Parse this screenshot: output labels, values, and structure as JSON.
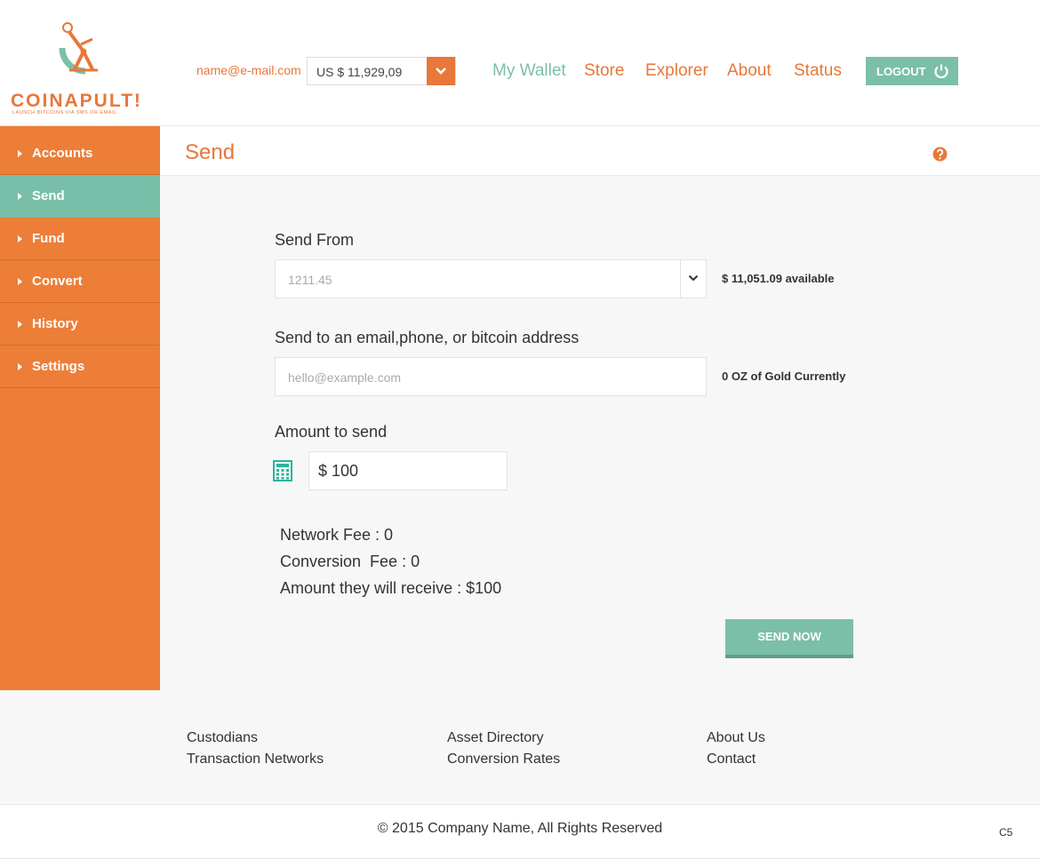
{
  "brand": {
    "name": "COINAPULT!",
    "tagline": "LAUNCH BITCOINS VIA SMS OR EMAIL",
    "accent": "#e8773a",
    "secondary": "#7bbfa8"
  },
  "header": {
    "email": "name@e-mail.com",
    "balance": "US $ 11,929,09",
    "nav": [
      "My Wallet",
      "Store",
      "Explorer",
      "About",
      "Status"
    ],
    "logout": "LOGOUT"
  },
  "sidebar": {
    "items": [
      {
        "label": "Accounts"
      },
      {
        "label": "Send"
      },
      {
        "label": "Fund"
      },
      {
        "label": "Convert"
      },
      {
        "label": "History"
      },
      {
        "label": "Settings"
      }
    ]
  },
  "main": {
    "title": "Send",
    "send_from": {
      "label": "Send From",
      "value": "1211.45",
      "available": "$ 11,051.09 available"
    },
    "send_to": {
      "label": "Send to an email,phone, or bitcoin address",
      "placeholder": "hello@example.com",
      "note": "0 OZ of Gold Currently"
    },
    "amount": {
      "label": "Amount to send",
      "value": "$ 100"
    },
    "summary": {
      "network_fee": "Network Fee : 0",
      "conversion_fee": "Conversion  Fee : 0",
      "receive": "Amount they will receive : $100"
    },
    "send_button": "SEND NOW"
  },
  "footer": {
    "links": [
      "Custodians",
      "Transaction Networks",
      "Asset Directory",
      "Conversion Rates",
      "About Us",
      "Contact"
    ],
    "copyright": "© 2015 Company Name, All Rights Reserved",
    "badge": "C5"
  }
}
